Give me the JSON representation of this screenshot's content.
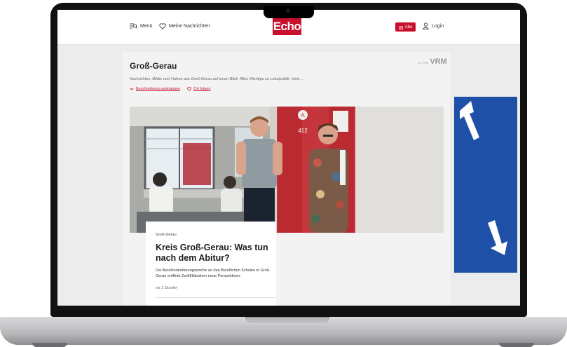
{
  "header": {
    "menu_label": "Menü",
    "news_label": "Meine Nachrichten",
    "logo_text": "Echo",
    "abo_label": "Abo",
    "login_label": "Login"
  },
  "page": {
    "title": "Groß-Gerau",
    "publisher_prefix": "ein VRM",
    "publisher_logo": "VRM",
    "description": "Nachrichten, Bilder und Videos aus Groß-Gerau auf einen Blick. Alles Wichtige zu Lokalpolitik, Verk…",
    "expand_label": "Beschreibung ausklappen",
    "follow_label": "Ort folgen"
  },
  "article": {
    "kicker": "Groß-Gerau",
    "headline": "Kreis Groß-Gerau: Was tun nach dem Abitur?",
    "teaser": "Die Berufsorientierungswoche an den Beruflichen Schulen in Groß-Gerau eröffnet Zwölftklässlern neue Perspektiven.",
    "time": "vor 2 Stunden",
    "photo_door_letter": "A",
    "photo_door_number": "412"
  },
  "colors": {
    "brand_red": "#c8102e",
    "ad_blue": "#1f50a8",
    "page_bg": "#ececec"
  },
  "icons": {
    "menu": "menu-search-icon",
    "news": "heart-icon",
    "abo": "gift-icon",
    "login": "user-icon",
    "expand": "chevron-down-icon",
    "follow": "heart-icon",
    "ad": "arrow-icon"
  }
}
